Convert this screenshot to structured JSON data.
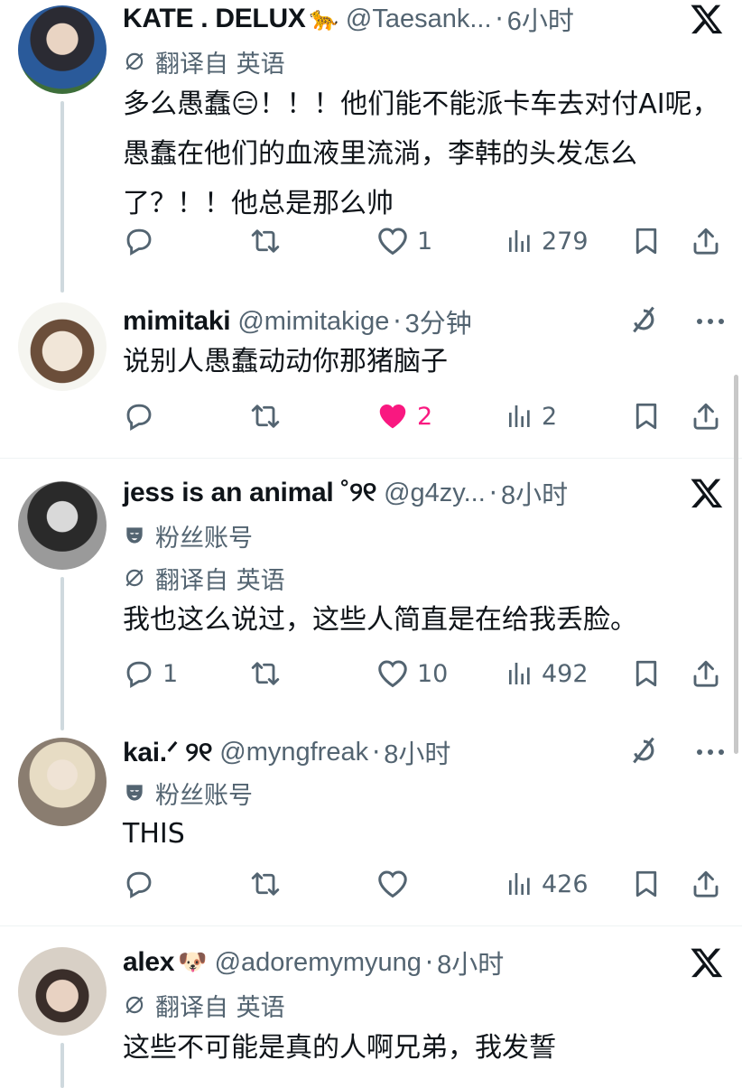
{
  "tweets": [
    {
      "name": "KATE . DELUX",
      "emoji": "🐆",
      "handle": "@Taesank...",
      "sep": "·",
      "time": "6小时",
      "translated": "翻译自 英语",
      "text": "多么愚蠢😑！！！他们能不能派卡车去对付AI呢，愚蠢在他们的血液里流淌，李韩的头发怎么了？！！他总是那么帅",
      "replies": "",
      "retweets": "",
      "likes": "1",
      "views": "279",
      "liked": false,
      "avatar_color": "#3a4a5c"
    },
    {
      "name": "mimitaki",
      "emoji": "",
      "handle": "@mimitakige",
      "sep": "·",
      "time": "3分钟",
      "text": "说别人愚蠢动动你那猪脑子",
      "replies": "",
      "retweets": "",
      "likes": "2",
      "views": "2",
      "liked": true,
      "avatar_color": "#e9e2d6"
    },
    {
      "name": "jess is an animal ˚୨୧",
      "emoji": "",
      "handle": "@g4zy...",
      "sep": "·",
      "time": "8小时",
      "fan_label": "粉丝账号",
      "translated": "翻译自 英语",
      "text": "我也这么说过，这些人简直是在给我丢脸。",
      "replies": "1",
      "retweets": "",
      "likes": "10",
      "views": "492",
      "liked": false,
      "avatar_color": "#6b6b6b"
    },
    {
      "name": "kai.ᐟ ୨୧",
      "emoji": "",
      "handle": "@myngfreak",
      "sep": "·",
      "time": "8小时",
      "fan_label": "粉丝账号",
      "text": "THIS",
      "replies": "",
      "retweets": "",
      "likes": "",
      "views": "426",
      "liked": false,
      "avatar_color": "#d8cfc4"
    },
    {
      "name": "alex",
      "emoji": "🐶",
      "handle": "@adoremymyung",
      "sep": "·",
      "time": "8小时",
      "translated": "翻译自 英语",
      "text": "这些不可能是真的人啊兄弟，我发誓",
      "avatar_color": "#c9b8a8"
    }
  ],
  "icons": {
    "reply": "reply-icon",
    "retweet": "retweet-icon",
    "like": "heart-icon",
    "views": "views-icon",
    "bookmark": "bookmark-icon",
    "share": "share-icon",
    "translate": "translate-icon",
    "fan": "mask-icon",
    "brand": "x-logo-icon",
    "grok": "grok-icon",
    "more": "more-icon"
  },
  "colors": {
    "like_active": "#f91880",
    "muted": "#536471",
    "text": "#0f1419"
  }
}
